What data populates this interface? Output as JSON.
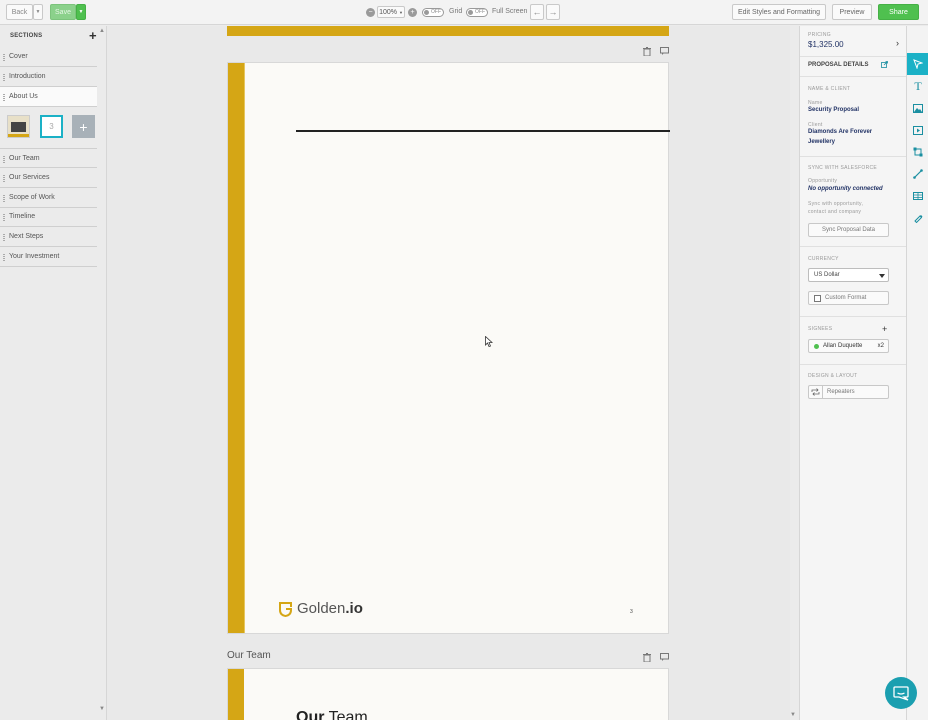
{
  "toolbar": {
    "back_label": "Back",
    "save_label": "Save",
    "zoom_value": "100%",
    "grid_label": "Grid",
    "fullscreen_label": "Full Screen",
    "toggle_state": "OFF",
    "edit_styles_label": "Edit Styles and Formatting",
    "preview_label": "Preview",
    "share_label": "Share"
  },
  "sidebar": {
    "header": "SECTIONS",
    "items": [
      {
        "label": "Cover"
      },
      {
        "label": "Introduction"
      },
      {
        "label": "About Us"
      },
      {
        "label": "Our Team"
      },
      {
        "label": "Our Services"
      },
      {
        "label": "Scope of Work"
      },
      {
        "label": "Timeline"
      },
      {
        "label": "Next Steps"
      },
      {
        "label": "Your Investment"
      }
    ],
    "page_thumb_number": "3"
  },
  "canvas": {
    "logo_text_a": "Golden",
    "logo_text_b": ".io",
    "page_number": "3",
    "next_section_title": "Our Team",
    "next_page_heading_a": "Our",
    "next_page_heading_b": " Team"
  },
  "panel": {
    "pricing_label": "PRICING",
    "pricing_value": "$1,325.00",
    "details_header": "PROPOSAL DETAILS",
    "name_client_header": "NAME & CLIENT",
    "name_label": "Name",
    "name_value": "Security Proposal",
    "client_label": "Client",
    "client_value_line1": "Diamonds Are Forever",
    "client_value_line2": "Jewellery",
    "sync_header": "SYNC WITH SALESFORCE",
    "opportunity_label": "Opportunity",
    "opportunity_value": "No opportunity connected",
    "sync_hint_line1": "Sync with opportunity,",
    "sync_hint_line2": "contact and company",
    "sync_button": "Sync Proposal Data",
    "currency_header": "CURRENCY",
    "currency_value": "US Dollar",
    "custom_format_label": "Custom Format",
    "signees_header": "SIGNEES",
    "signee_name": "Allan Duquette",
    "signee_count": "x2",
    "design_header": "DESIGN & LAYOUT",
    "repeaters_label": "Repeaters"
  },
  "colors": {
    "gold_accent": "#d5a615",
    "teal_accent": "#1bb1c6",
    "share_green": "#4fc04f"
  }
}
